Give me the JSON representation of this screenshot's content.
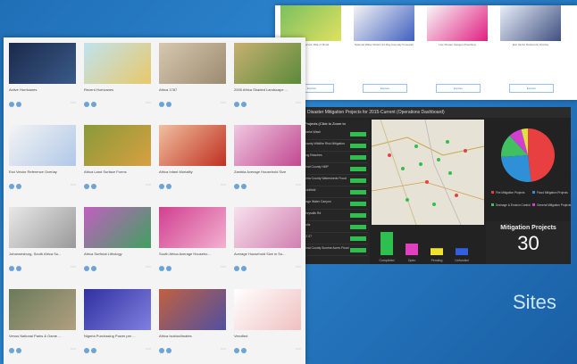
{
  "gallery": {
    "cards": [
      {
        "title": "Active Hurricanes",
        "c1": "#1a2a4a",
        "c2": "#3a5a8a"
      },
      {
        "title": "Recent Hurricanes",
        "c1": "#bfe3ef",
        "c2": "#e8c86a"
      },
      {
        "title": "Africa 1787",
        "c1": "#d6c8b0",
        "c2": "#9b8b70"
      },
      {
        "title": "2005 Africa Shaded Landscape ...",
        "c1": "#c8b070",
        "c2": "#5a8a3a"
      },
      {
        "title": "Esri Vector Reference Overlay",
        "c1": "#f4f4f4",
        "c2": "#b0c8e8"
      },
      {
        "title": "Africa Land Surface Forms",
        "c1": "#8a9a3a",
        "c2": "#d8a040"
      },
      {
        "title": "Africa Infant Mortality",
        "c1": "#f0c0a0",
        "c2": "#c03020"
      },
      {
        "title": "Zambia Average Household Size",
        "c1": "#f0c8e0",
        "c2": "#c04890"
      },
      {
        "title": "Johannesburg, South Africa Su...",
        "c1": "#e8e8e8",
        "c2": "#999999"
      },
      {
        "title": "Africa Surficial Lithology",
        "c1": "#c060c0",
        "c2": "#40a060"
      },
      {
        "title": "South Africa Average Househo...",
        "c1": "#d04090",
        "c2": "#f4b0d0"
      },
      {
        "title": "Average Household Size in So...",
        "c1": "#f8e0ec",
        "c2": "#d080b0"
      },
      {
        "title": "Venus National Parks & Game ...",
        "c1": "#6a7a5a",
        "c2": "#b0a080"
      },
      {
        "title": "Nigeria Purchasing Power per ...",
        "c1": "#3030a0",
        "c2": "#8080e0"
      },
      {
        "title": "Africa Isobioclimates",
        "c1": "#c06040",
        "c2": "#5050a0"
      },
      {
        "title": "Vexufied",
        "c1": "#ffffff",
        "c2": "#f0c0c0"
      }
    ]
  },
  "top_gallery": {
    "cards": [
      {
        "title": "Weather Service Risk of Flood",
        "button": "Explore",
        "c1": "#7ac060",
        "c2": "#e0e060"
      },
      {
        "title": "National Water Model (12-Day Anomaly Forecast)",
        "button": "Explore",
        "c1": "#f4f4f4",
        "c2": "#4060c0"
      },
      {
        "title": "Live Stream Gauges (Flooding)",
        "button": "Explore",
        "c1": "#f8f8f8",
        "c2": "#e02080"
      },
      {
        "title": "Esri Vector Reference Overlay",
        "button": "Explore",
        "c1": "#e8eef8",
        "c2": "#405080"
      }
    ]
  },
  "dashboard": {
    "title": "Disaster Mitigation Projects for 2015-Current (Operations Dashboard)",
    "list_title": "Projects (Click to Zoom to",
    "list": [
      "Clarks Wash",
      "County Wildfire Risk Mitigation",
      "Dog Reaches",
      "Pinal County HMP",
      "Pima County Watersheds Flood",
      "Goldfield",
      "Cage Water Canyon",
      "Chrysalis Rd",
      "Kolls",
      "AZ 07",
      "Pinal County Sunrise Acres Flood"
    ],
    "bars": {
      "categories": [
        "Completed",
        "Open",
        "Pending",
        "Unfunded"
      ],
      "values": [
        10,
        5,
        3,
        3
      ],
      "colors": [
        "#2fbf4f",
        "#e040c0",
        "#f0e030",
        "#3060e0"
      ]
    },
    "pie": {
      "values": [
        48,
        26,
        14,
        8,
        4
      ],
      "colors": [
        "#e84040",
        "#2f90d8",
        "#40c060",
        "#d040d0",
        "#e0e040"
      ]
    },
    "legend": [
      "Fire Mitigation Projects",
      "Flood Mitigation Projects",
      "Drainage & Erosion Control",
      "General Mitigation Projects"
    ],
    "indicator_label": "Mitigation Projects",
    "indicator_value": "30"
  },
  "sites_label": "Sites"
}
